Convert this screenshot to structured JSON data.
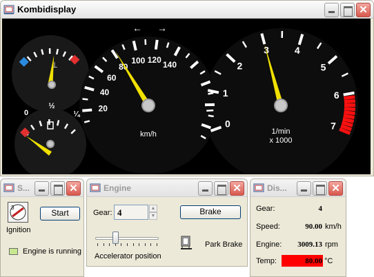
{
  "main_window": {
    "title": "Kombidisplay"
  },
  "dashboard": {
    "speedometer": {
      "major_labels": [
        "20",
        "40",
        "60",
        "80",
        "100",
        "120",
        "140"
      ],
      "unit": "km/h",
      "needle_value": 82
    },
    "tachometer": {
      "labels": [
        "0",
        "1",
        "2",
        "3",
        "4",
        "5",
        "6",
        "7"
      ],
      "unit_line1": "1/min",
      "unit_line2": "x 1000",
      "needle_value": 3.0
    },
    "fuel_gauge": {
      "labels": [
        "0",
        "½",
        "¼"
      ],
      "needle_value": 0.0
    },
    "temp_gauge": {
      "needle_value": 0.45
    },
    "turn_signal_left": "←",
    "turn_signal_right": "→"
  },
  "start_window": {
    "title": "S...",
    "start_label": "Start",
    "ignition_key_position": "3",
    "ignition_label": "Ignition",
    "engine_status": "Engine is running"
  },
  "engine_window": {
    "title": "Engine",
    "gear_label": "Gear:",
    "gear_value": "4",
    "brake_label": "Brake",
    "accelerator_label": "Accelerator position",
    "accelerator_value": 0.3,
    "park_brake_label": "Park Brake"
  },
  "display_window": {
    "title": "Dis...",
    "rows": [
      {
        "label": "Gear:",
        "value": "4",
        "unit": ""
      },
      {
        "label": "Speed:",
        "value": "90.00",
        "unit": "km/h"
      },
      {
        "label": "Engine:",
        "value": "3009.13",
        "unit": "rpm"
      },
      {
        "label": "Temp:",
        "value": "80.00",
        "unit": "°C"
      }
    ],
    "temp_highlight_color": "#ff0000"
  },
  "colors": {
    "needle": "#f0e000",
    "redzone": "#ff1010",
    "dash_background": "#000000",
    "status_led": "#c8e890"
  }
}
